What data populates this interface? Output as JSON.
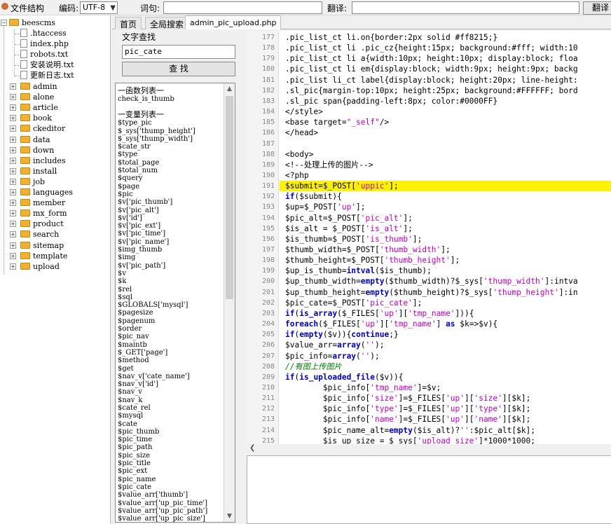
{
  "toolbar": {
    "file_structure_label": "文件结构",
    "encoding_label": "编码:",
    "encoding_value": "UTF-8",
    "word_query_label": "词句:",
    "word_query_value": "",
    "translate_label": "翻译:",
    "translate_value": "",
    "translate_button": "翻译"
  },
  "tree": {
    "root": "beescms",
    "files": [
      ".htaccess",
      "index.php",
      "robots.txt",
      "安装说明.txt",
      "更新日志.txt"
    ],
    "folders": [
      "admin",
      "alone",
      "article",
      "book",
      "ckeditor",
      "data",
      "down",
      "includes",
      "install",
      "job",
      "languages",
      "member",
      "mx_form",
      "product",
      "search",
      "sitemap",
      "template",
      "upload"
    ]
  },
  "tabs": [
    "首页",
    "全局搜索",
    "admin_pic_upload.php"
  ],
  "search": {
    "title": "文字查找",
    "input_value": "pic_cate",
    "button_label": "查 找"
  },
  "varlist": {
    "functions_header": "一函数列表一",
    "functions": [
      "check_is_thumb"
    ],
    "variables_header": "一变量列表一",
    "variables": [
      "$type_pic",
      "$_sys['thump_height']",
      "$_sys['thump_width']",
      "$cate_str",
      "$type",
      "$total_page",
      "$total_num",
      "$query",
      "$page",
      "$pic",
      "$v['pic_thumb']",
      "$v['pic_alt']",
      "$v['id']",
      "$v['pic_ext']",
      "$v['pic_time']",
      "$v['pic_name']",
      "$img_thumb",
      "$img",
      "$v['pic_path']",
      "$v",
      "$k",
      "$rel",
      "$sql",
      "$GLOBALS['mysql']",
      "$pagesize",
      "$pagenum",
      "$order",
      "$pic_nav",
      "$maintb",
      "$_GET['page']",
      "$method",
      "$get",
      "$nav_v['cate_name']",
      "$nav_v['id']",
      "$nav_v",
      "$nav_k",
      "$cate_rel",
      "$mysql",
      "$cate",
      "$pic_thumb",
      "$pic_time",
      "$pic_path",
      "$pic_size",
      "$pic_title",
      "$pic_ext",
      "$pic_name",
      "$pic_cate",
      "$value_arr['thumb']",
      "$value_arr['up_pic_time']",
      "$value_arr['up_pic_path']",
      "$value_arr['up_pic_size']"
    ]
  },
  "editor": {
    "highlight_line": 191,
    "lines": [
      {
        "n": "177",
        "t": "    .pic_list_ct li.on{border:2px solid #ff8215;}"
      },
      {
        "n": "178",
        "t": "    .pic_list_ct li .pic_cz{height:15px; background:#fff; width:10"
      },
      {
        "n": "179",
        "t": "    .pic_list_ct li a{width:10px; height:10px; display:block; floa"
      },
      {
        "n": "180",
        "t": "    .pic_list_ct li em{display:block; width:9px; height:9px; backg"
      },
      {
        "n": "181",
        "t": "    .pic_list li_ct label{display:block; height:20px; line-height:"
      },
      {
        "n": "182",
        "t": "    .sl_pic{margin-top:10px; height:25px; background:#FFFFFF; bord"
      },
      {
        "n": "183",
        "t": "    .sl_pic span{padding-left:8px; color:#0000FF}"
      },
      {
        "n": "184",
        "t": "    </style>"
      },
      {
        "n": "185",
        "t": "    <base target=\"_self\"/>"
      },
      {
        "n": "186",
        "t": "    </head>"
      },
      {
        "n": "187",
        "t": ""
      },
      {
        "n": "188",
        "t": "    <body>"
      },
      {
        "n": "189",
        "t": "    <!--处理上传的图片-->"
      },
      {
        "n": "190",
        "t": "    <?php"
      },
      {
        "n": "191",
        "t": "    $submit=$_POST['uppic'];"
      },
      {
        "n": "192",
        "t": "    if($submit){"
      },
      {
        "n": "193",
        "t": "    $up=$_POST['up'];"
      },
      {
        "n": "194",
        "t": "    $pic_alt=$_POST['pic_alt'];"
      },
      {
        "n": "195",
        "t": "    $is_alt = $_POST['is_alt'];"
      },
      {
        "n": "196",
        "t": "    $is_thumb=$_POST['is_thumb'];"
      },
      {
        "n": "197",
        "t": "    $thumb_width=$_POST['thumb_width'];"
      },
      {
        "n": "198",
        "t": "    $thumb_height=$_POST['thumb_height'];"
      },
      {
        "n": "199",
        "t": "    $up_is_thumb=intval($is_thumb);"
      },
      {
        "n": "200",
        "t": "    $up_thumb_width=empty($thumb_width)?$_sys['thump_width']:intva"
      },
      {
        "n": "201",
        "t": "    $up_thumb_height=empty($thumb_height)?$_sys['thump_height']:in"
      },
      {
        "n": "202",
        "t": "    $pic_cate=$_POST['pic_cate'];"
      },
      {
        "n": "203",
        "t": "    if(is_array($_FILES['up']['tmp_name'])){"
      },
      {
        "n": "204",
        "t": "    foreach($_FILES['up']['tmp_name'] as $k=>$v){"
      },
      {
        "n": "205",
        "t": "    if(empty($v)){continue;}"
      },
      {
        "n": "206",
        "t": "    $value_arr=array('');"
      },
      {
        "n": "207",
        "t": "    $pic_info=array('');"
      },
      {
        "n": "208",
        "t": "    //有图上传图片"
      },
      {
        "n": "209",
        "t": "    if(is_uploaded_file($v)){"
      },
      {
        "n": "210",
        "t": "            $pic_info['tmp_name']=$v;"
      },
      {
        "n": "211",
        "t": "            $pic_info['size']=$_FILES['up']['size'][$k];"
      },
      {
        "n": "212",
        "t": "            $pic_info['type']=$_FILES['up']['type'][$k];"
      },
      {
        "n": "213",
        "t": "            $pic_info['name']=$_FILES['up']['name'][$k];"
      },
      {
        "n": "214",
        "t": "            $pic_name_alt=empty($is_alt)?'':$pic_alt[$k];"
      },
      {
        "n": "215",
        "t": "            $is_up_size = $_sys['upload_size']*1000*1000;"
      }
    ]
  },
  "colors": {
    "highlight": "#fff200",
    "keyword": "#0000c0",
    "string": "#c000c0",
    "comment": "#008000"
  }
}
